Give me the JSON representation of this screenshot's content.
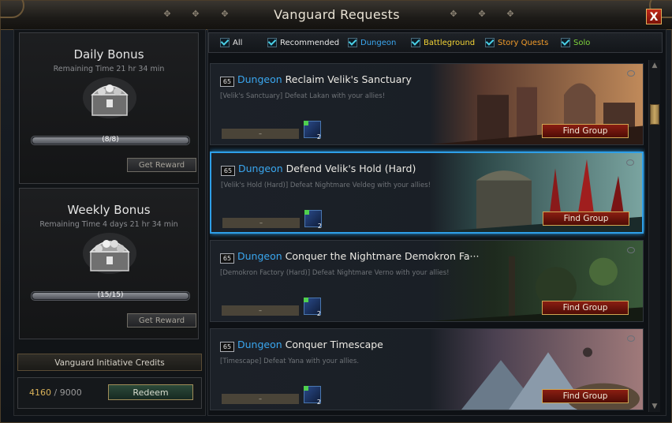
{
  "window": {
    "title": "Vanguard Requests",
    "close_label": "X"
  },
  "daily": {
    "title": "Daily Bonus",
    "time": "Remaining Time 21 hr 34 min",
    "progress_text": "(8/8)",
    "progress": 1.0,
    "button": "Get Reward"
  },
  "weekly": {
    "title": "Weekly Bonus",
    "time": "Remaining Time 4 days 21 hr 34 min",
    "progress_text": "(15/15)",
    "progress": 1.0,
    "button": "Get Reward"
  },
  "credits": {
    "header": "Vanguard Initiative Credits",
    "current": "4160",
    "sep": "/",
    "max": "9000",
    "redeem": "Redeem"
  },
  "filters": [
    {
      "label": "All",
      "color": "#e6e6e6",
      "checked": true
    },
    {
      "label": "Recommended",
      "color": "#e6e6e6",
      "checked": true
    },
    {
      "label": "Dungeon",
      "color": "#3aa6ef",
      "checked": true
    },
    {
      "label": "Battleground",
      "color": "#f2d335",
      "checked": true
    },
    {
      "label": "Story Quests",
      "color": "#f09a2a",
      "checked": true
    },
    {
      "label": "Solo",
      "color": "#7ed43b",
      "checked": true
    }
  ],
  "requests": [
    {
      "level": "65",
      "category": "Dungeon",
      "title": "Reclaim Velik's Sanctuary",
      "desc": "[Velik's Sanctuary] Defeat Lakan with your allies!",
      "slot": "–",
      "reward_count": "2",
      "button": "Find Group",
      "selected": false
    },
    {
      "level": "65",
      "category": "Dungeon",
      "title": "Defend Velik's Hold (Hard)",
      "desc": "[Velik's Hold (Hard)] Defeat Nightmare Veldeg with your allies!",
      "slot": "–",
      "reward_count": "2",
      "button": "Find Group",
      "selected": true
    },
    {
      "level": "65",
      "category": "Dungeon",
      "title": "Conquer the Nightmare Demokron Fa···",
      "desc": "[Demokron Factory (Hard)] Defeat Nightmare Verno with your allies!",
      "slot": "–",
      "reward_count": "2",
      "button": "Find Group",
      "selected": false
    },
    {
      "level": "65",
      "category": "Dungeon",
      "title": "Conquer Timescape",
      "desc": "[Timescape] Defeat Yana with your allies.",
      "slot": "–",
      "reward_count": "2",
      "button": "Find Group",
      "selected": false
    }
  ],
  "icons": {
    "close": "close-icon",
    "chest": "treasure-chest-icon",
    "reward": "reward-crystal-icon",
    "eye": "eye-icon"
  }
}
